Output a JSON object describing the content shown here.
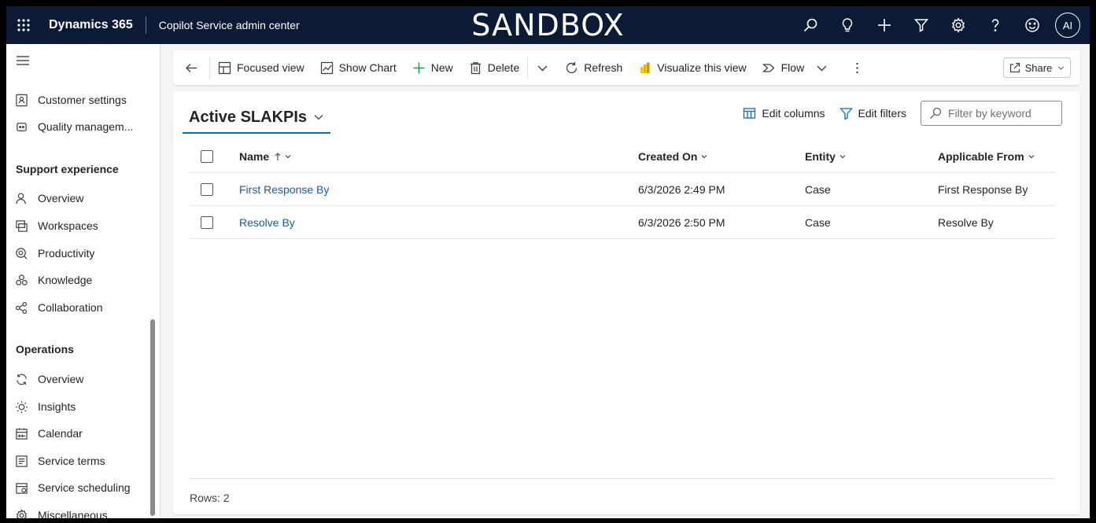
{
  "topbar": {
    "brand": "Dynamics 365",
    "app_name": "Copilot Service admin center",
    "environment": "SANDBOX",
    "avatar_initials": "AI",
    "background_color": "#0b1a35"
  },
  "sidebar": {
    "items_top": [
      {
        "label": "Customer settings",
        "icon": "contact-card-icon"
      },
      {
        "label": "Quality managem...",
        "icon": "quality-icon"
      }
    ],
    "section_support": "Support experience",
    "support_items": [
      {
        "label": "Overview",
        "icon": "person-icon"
      },
      {
        "label": "Workspaces",
        "icon": "workspaces-icon"
      },
      {
        "label": "Productivity",
        "icon": "productivity-icon"
      },
      {
        "label": "Knowledge",
        "icon": "knowledge-icon"
      },
      {
        "label": "Collaboration",
        "icon": "collaboration-icon"
      }
    ],
    "section_operations": "Operations",
    "operations_items": [
      {
        "label": "Overview",
        "icon": "sync-icon"
      },
      {
        "label": "Insights",
        "icon": "lightbulb-icon"
      },
      {
        "label": "Calendar",
        "icon": "calendar-icon"
      },
      {
        "label": "Service terms",
        "icon": "document-icon"
      },
      {
        "label": "Service scheduling",
        "icon": "schedule-icon"
      },
      {
        "label": "Miscellaneous",
        "icon": "gear-icon"
      }
    ]
  },
  "commandbar": {
    "focused_view": "Focused view",
    "show_chart": "Show Chart",
    "new": "New",
    "delete": "Delete",
    "refresh": "Refresh",
    "visualize": "Visualize this view",
    "flow": "Flow",
    "share": "Share"
  },
  "view": {
    "title": "Active SLAKPIs",
    "edit_columns": "Edit columns",
    "edit_filters": "Edit filters",
    "filter_placeholder": "Filter by keyword",
    "accent_color": "#0f6cbd"
  },
  "grid": {
    "columns": [
      "Name",
      "Created On",
      "Entity",
      "Applicable From"
    ],
    "rows": [
      {
        "name": "First Response By",
        "created_on": "6/3/2026 2:49 PM",
        "entity": "Case",
        "applicable_from": "First Response By"
      },
      {
        "name": "Resolve By",
        "created_on": "6/3/2026 2:50 PM",
        "entity": "Case",
        "applicable_from": "Resolve By"
      }
    ],
    "rows_label": "Rows: 2"
  }
}
